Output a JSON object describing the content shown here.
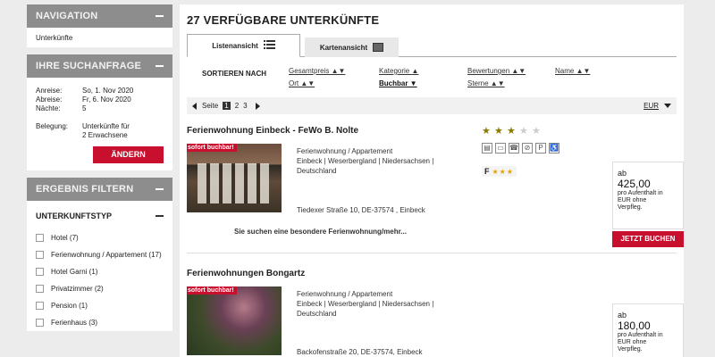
{
  "sidebar": {
    "navigation": {
      "title": "NAVIGATION",
      "link": "Unterkünfte"
    },
    "search": {
      "title": "IHRE SUCHANFRAGE",
      "rows": [
        {
          "k": "Anreise:",
          "v": "So, 1. Nov 2020"
        },
        {
          "k": "Abreise:",
          "v": "Fr, 6. Nov 2020"
        },
        {
          "k": "Nächte:",
          "v": "5"
        }
      ],
      "belegung_label": "Belegung:",
      "belegung_value_1": "Unterkünfte für",
      "belegung_value_2": "2 Erwachsene",
      "change_button": "ÄNDERN"
    },
    "filter": {
      "title": "ERGEBNIS FILTERN",
      "subtitle": "UNTERKUNFTSTYP",
      "options": [
        "Hotel (7)",
        "Ferienwohnung / Appartement (17)",
        "Hotel Garni (1)",
        "Privatzimmer (2)",
        "Pension (1)",
        "Ferienhaus (3)"
      ]
    }
  },
  "main": {
    "title": "27 VERFÜGBARE UNTERKÜNFTE",
    "tabs": {
      "list": "Listenansicht",
      "map": "Kartenansicht"
    },
    "sort": {
      "label": "SORTIEREN NACH",
      "gesamtpreis": "Gesamtpreis ▲▼",
      "kategorie": "Kategorie ▲",
      "bewertungen": "Bewertungen ▲▼",
      "name": "Name ▲▼",
      "ort": "Ort ▲▼",
      "buchbar": "Buchbar ▼",
      "sterne": "Sterne ▲▼"
    },
    "pagination": {
      "label": "Seite",
      "pages": [
        "1",
        "2",
        "3"
      ],
      "currency": "EUR"
    },
    "listings": [
      {
        "name": "Ferienwohnung Einbeck - FeWo B. Nolte",
        "badge": "sofort buchbar!",
        "type": "Ferienwohnung / Appartement",
        "region": "Einbeck | Weserbergland | Niedersachsen |",
        "country": "Deutschland",
        "address": "Tiedexer Straße 10, DE-37574 , Einbeck",
        "more": "Sie suchen eine besondere Ferienwohnung/mehr...",
        "stars": 3,
        "price_prefix": "ab",
        "price": "425,00",
        "price_note_1": "pro Aufenthalt in",
        "price_note_2": "EUR ohne",
        "price_note_3": "Verpfleg.",
        "book_button": "JETZT BUCHEN",
        "dtv_letter": "F",
        "dtv_stars": "★★★"
      },
      {
        "name": "Ferienwohnungen Bongartz",
        "badge": "sofort buchbar!",
        "type": "Ferienwohnung / Appartement",
        "region": "Einbeck | Weserbergland | Niedersachsen |",
        "country": "Deutschland",
        "address": "Backofenstraße 20, DE-37574, Einbeck",
        "price_prefix": "ab",
        "price": "180,00",
        "price_note_1": "pro Aufenthalt in",
        "price_note_2": "EUR ohne",
        "price_note_3": "Verpfleg."
      }
    ]
  },
  "colors": {
    "accent": "#c8102e",
    "panel_header": "#8d8d8d",
    "page_bg": "#ececec"
  }
}
